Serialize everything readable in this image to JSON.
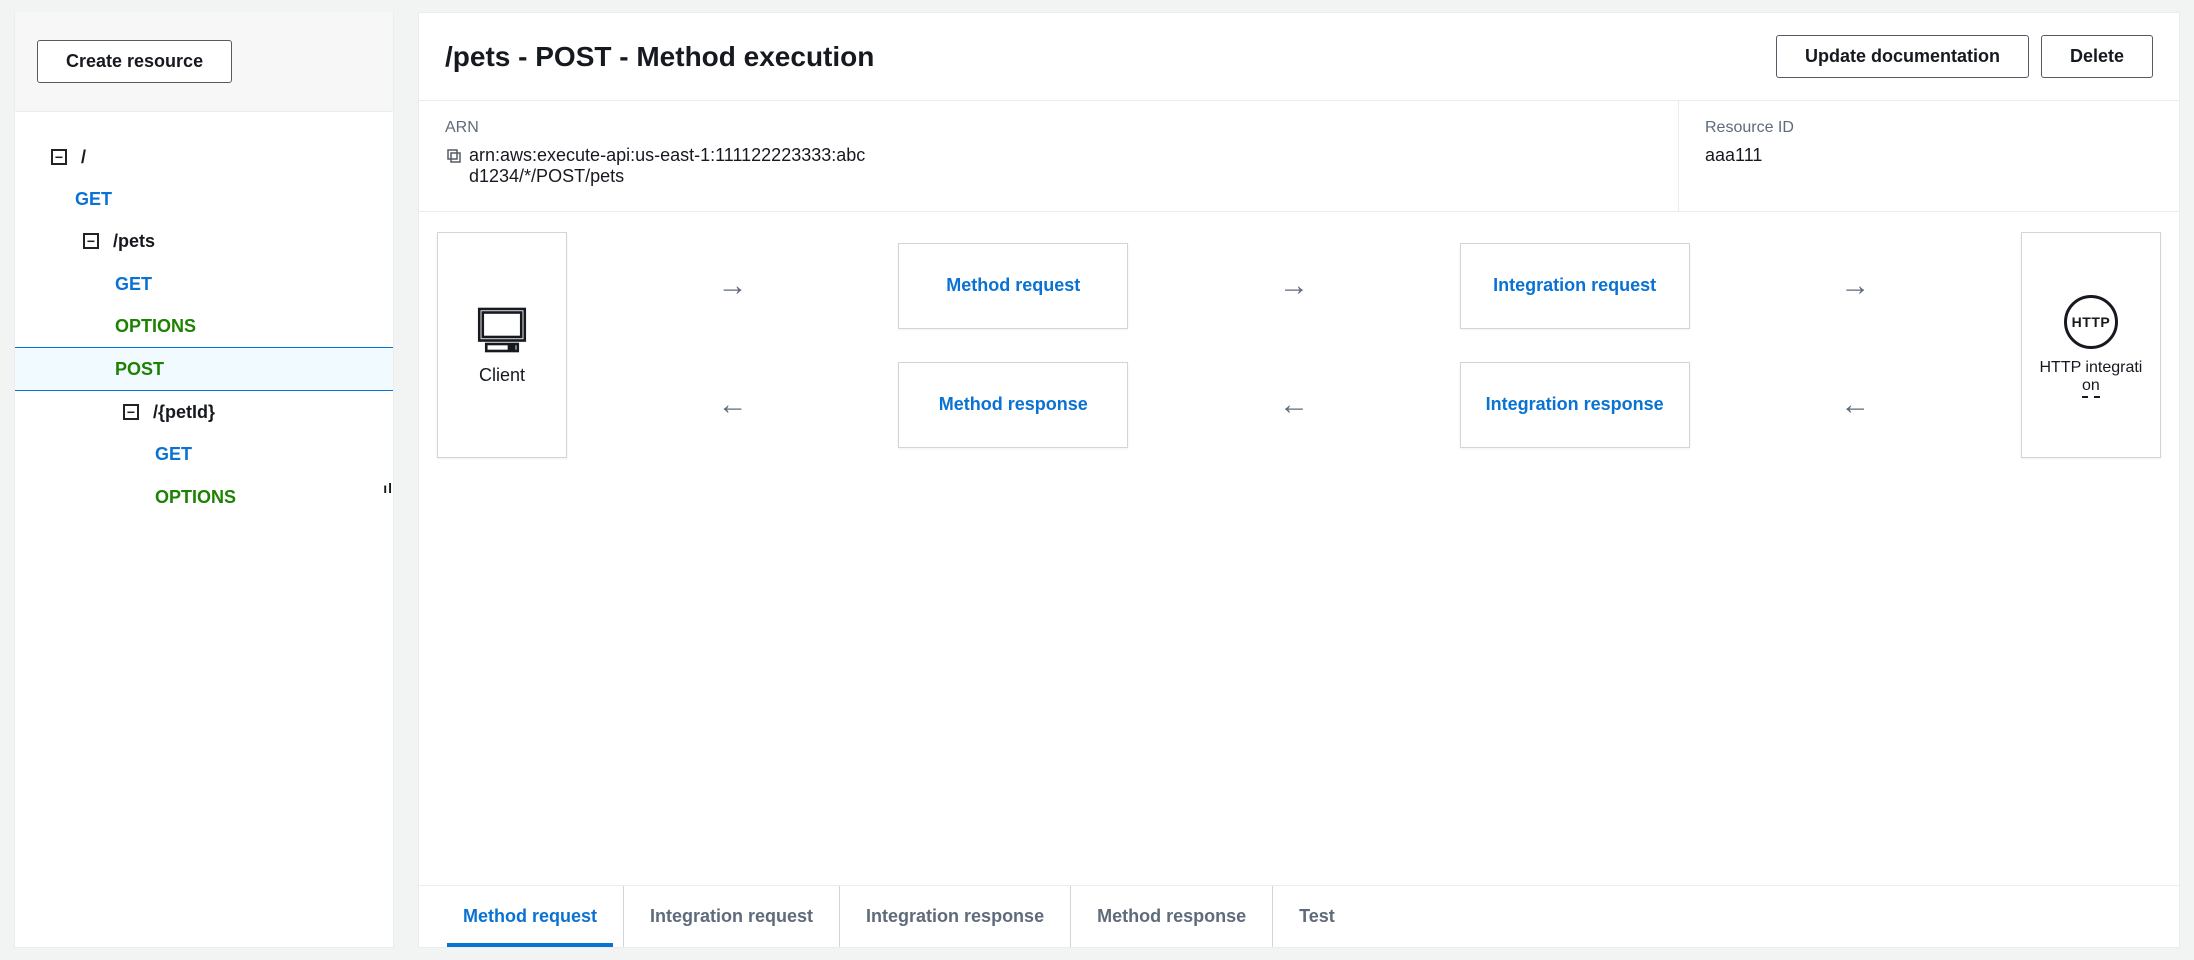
{
  "sidebar": {
    "create_btn": "Create resource",
    "tree": {
      "root": "/",
      "root_get": "GET",
      "pets": "/pets",
      "pets_get": "GET",
      "pets_options": "OPTIONS",
      "pets_post": "POST",
      "petid": "/{petId}",
      "petid_get": "GET",
      "petid_options": "OPTIONS"
    }
  },
  "header": {
    "title": "/pets - POST - Method execution",
    "update_doc": "Update documentation",
    "delete": "Delete"
  },
  "info": {
    "arn_label": "ARN",
    "arn_value": "arn:aws:execute-api:us-east-1:111122223333:abcd1234/*/POST/pets",
    "resource_id_label": "Resource ID",
    "resource_id_value": "aaa111"
  },
  "flow": {
    "client": "Client",
    "method_request": "Method request",
    "integration_request": "Integration request",
    "method_response": "Method response",
    "integration_response": "Integration response",
    "http_badge": "HTTP",
    "http_line1": "HTTP integrati",
    "http_line2": "on"
  },
  "tabs": {
    "method_request": "Method request",
    "integration_request": "Integration request",
    "integration_response": "Integration response",
    "method_response": "Method response",
    "test": "Test"
  }
}
